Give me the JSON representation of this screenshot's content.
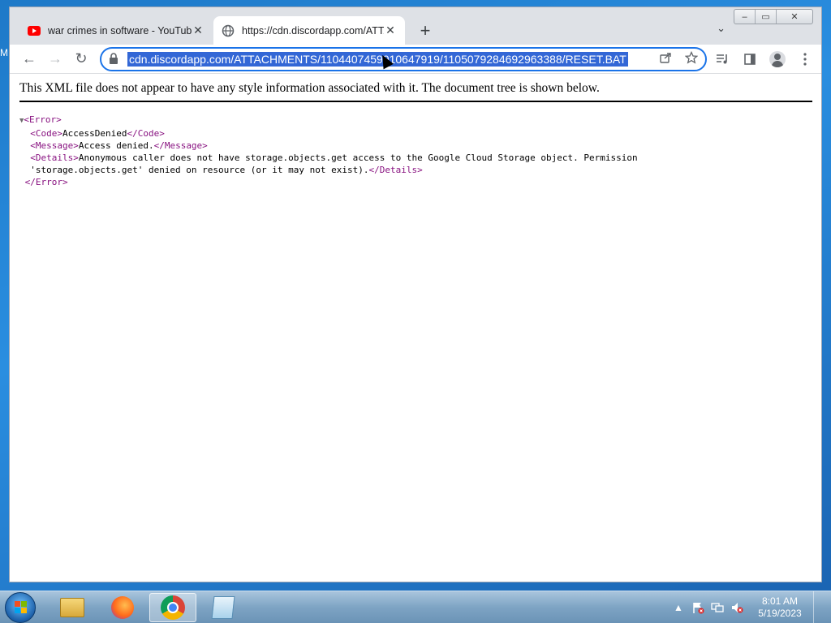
{
  "desktop": {
    "edge_glyph": "M"
  },
  "browser": {
    "window_controls": {
      "minimize": "–",
      "restore": "▭",
      "close": "✕"
    },
    "tabs": [
      {
        "title": "war crimes in software - YouTube",
        "favicon": "youtube-logo",
        "close": "✕"
      },
      {
        "title": "https://cdn.discordapp.com/ATTA",
        "favicon": "globe-icon",
        "close": "✕"
      }
    ],
    "new_tab": "+",
    "tab_search": "⌄",
    "nav": {
      "back": "←",
      "forward": "→",
      "reload": "↻"
    },
    "address_bar": {
      "url": "cdn.discordapp.com/ATTACHMENTS/1104407459910647919/1105079284692963388/RESET.BAT",
      "selected": true
    }
  },
  "page": {
    "notice": "This XML file does not appear to have any style information associated with it. The document tree is shown below.",
    "xml": {
      "root_open": "<Error>",
      "root_close": "</Error>",
      "code_open": "<Code>",
      "code_value": "AccessDenied",
      "code_close": "</Code>",
      "message_open": "<Message>",
      "message_value": "Access denied.",
      "message_close": "</Message>",
      "details_open": "<Details>",
      "details_value_line1": "Anonymous caller does not have storage.objects.get access to the Google Cloud Storage object. Permission",
      "details_value_line2": "'storage.objects.get' denied on resource (or it may not exist).",
      "details_close": "</Details>"
    }
  },
  "taskbar": {
    "apps": [
      "file-explorer",
      "firefox",
      "chrome",
      "notepad"
    ],
    "active_app": "chrome",
    "clock": {
      "time": "8:01 AM",
      "date": "5/19/2023"
    }
  }
}
